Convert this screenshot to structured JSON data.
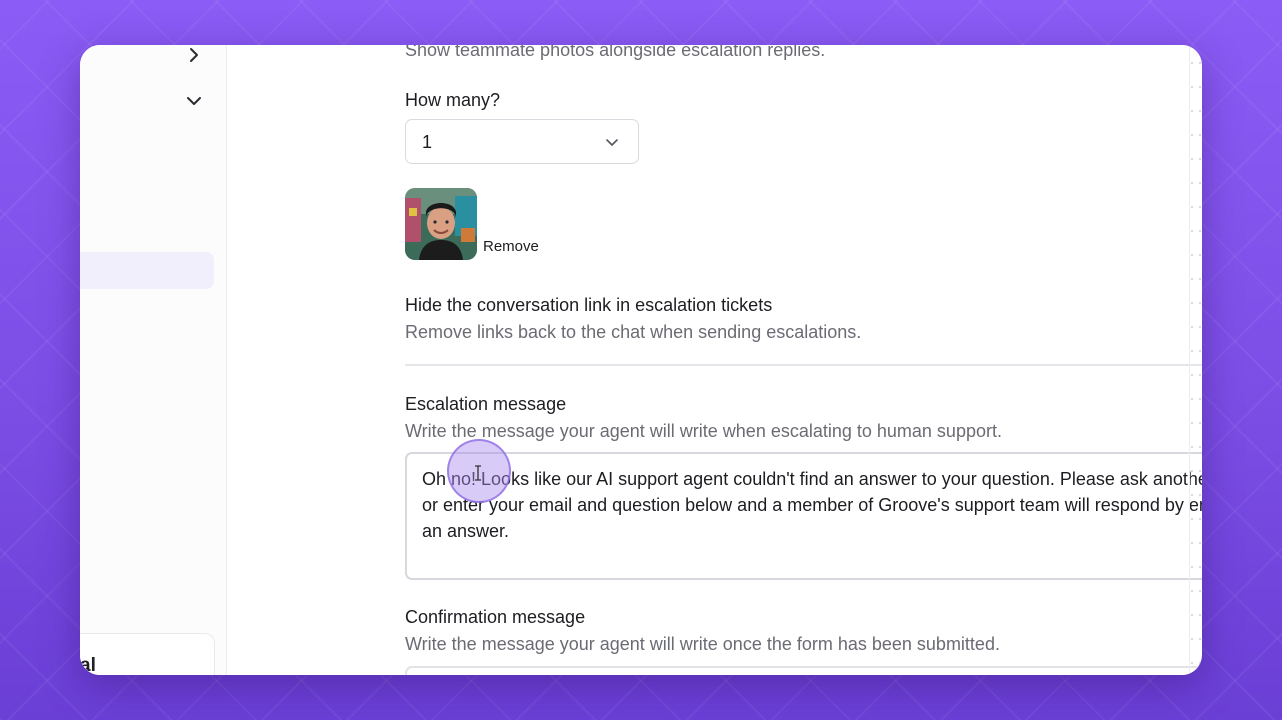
{
  "settings": {
    "photos_desc": "Show teammate photos alongside escalation replies.",
    "how_many_label": "How many?",
    "how_many_value": "1",
    "remove_label": "Remove",
    "hide_link_title": "Hide the conversation link in escalation tickets",
    "hide_link_desc": "Remove links back to the chat when sending escalations.",
    "hide_link_enabled": true,
    "escalation_title": "Escalation message",
    "escalation_desc": "Write the message your agent will write when escalating to human support.",
    "escalation_value": "Oh no! Looks like our AI support agent couldn't find an answer to your question. Please ask another question or enter your email and question below and a member of Groove's support team will respond by email with an answer.",
    "confirmation_title": "Confirmation message",
    "confirmation_desc": "Write the message your agent will write once the form has been submitted."
  },
  "sidebar": {
    "card_text": "al"
  },
  "icons": {
    "nav_expand": "chevron-right-icon",
    "nav_collapse": "chevron-down-icon",
    "select": "chevron-down-icon",
    "resize": "resize-handle-icon",
    "cursor": "text-cursor-icon"
  },
  "colors": {
    "background": "#8b5cf6",
    "toggle_on": "#1b1b1f",
    "selected_nav": "#f1effb"
  }
}
